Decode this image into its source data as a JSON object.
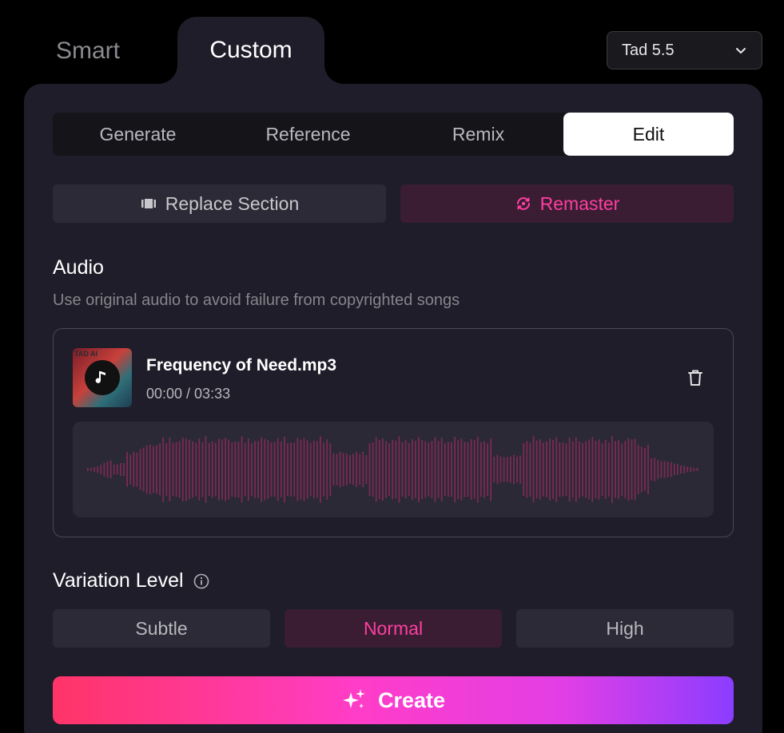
{
  "top_tabs": {
    "smart": "Smart",
    "custom": "Custom"
  },
  "model": {
    "selected": "Tad 5.5"
  },
  "sub_tabs": [
    "Generate",
    "Reference",
    "Remix",
    "Edit"
  ],
  "active_sub_tab": "Edit",
  "edit_modes": {
    "replace": "Replace Section",
    "remaster": "Remaster",
    "selected": "Remaster"
  },
  "audio": {
    "title": "Audio",
    "description": "Use original audio to avoid failure from copyrighted songs",
    "file_name": "Frequency of Need.mp3",
    "time": "00:00 / 03:33",
    "thumbnail_text": "TAD AI"
  },
  "variation": {
    "title": "Variation Level",
    "levels": [
      "Subtle",
      "Normal",
      "High"
    ],
    "selected": "Normal"
  },
  "create_label": "Create",
  "colors": {
    "accent": "#ff3fa0",
    "panel": "#1f1d29",
    "wave": "#7a2a55"
  }
}
